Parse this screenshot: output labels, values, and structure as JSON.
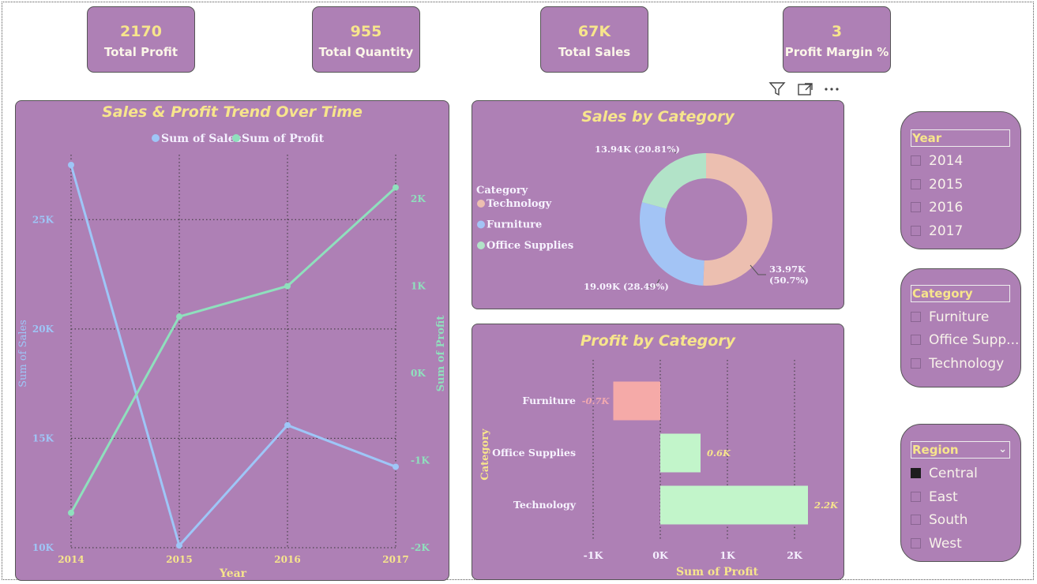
{
  "kpis": [
    {
      "value": "2170",
      "label": "Total Profit"
    },
    {
      "value": "955",
      "label": "Total Quantity"
    },
    {
      "value": "67K",
      "label": "Total Sales"
    },
    {
      "value": "3",
      "label": "Profit Margin %"
    }
  ],
  "colors": {
    "panel": "#ae80b5",
    "sales": "#9ec6f7",
    "profit": "#8fe0bd",
    "title": "#f7e58c",
    "technology": "#ecbfb0",
    "furniture": "#a3c4f5",
    "office": "#b2e3c8",
    "negative_bar": "#f5aaa8",
    "positive_bar": "#c2f5ca"
  },
  "icons": [
    "filter-icon",
    "focus-mode-icon",
    "more-options-icon"
  ],
  "slicers": {
    "year": {
      "header": "Year",
      "items": [
        "2014",
        "2015",
        "2016",
        "2017"
      ]
    },
    "category": {
      "header": "Category",
      "items": [
        "Furniture",
        "Office Supp...",
        "Technology"
      ]
    },
    "region": {
      "header": "Region",
      "items": [
        "Central",
        "East",
        "South",
        "West"
      ],
      "checked": [
        "Central"
      ]
    }
  },
  "chart_data": [
    {
      "type": "line",
      "title": "Sales & Profit Trend Over Time",
      "x": [
        "2014",
        "2015",
        "2016",
        "2017"
      ],
      "xlabel": "Year",
      "series": [
        {
          "name": "Sum of Sales",
          "axis": "left",
          "values": [
            27500,
            10100,
            15600,
            13700
          ]
        },
        {
          "name": "Sum of Profit",
          "axis": "right",
          "values": [
            -1600,
            650,
            1000,
            2130
          ]
        }
      ],
      "ylabel": "Sum of Sales",
      "ylim": [
        10000,
        27500
      ],
      "yticks": [
        10000,
        15000,
        20000,
        25000
      ],
      "ytick_labels": [
        "10K",
        "15K",
        "20K",
        "25K"
      ],
      "y2label": "Sum of Profit",
      "y2lim": [
        -2000,
        2000
      ],
      "y2ticks": [
        -2000,
        -1000,
        0,
        1000,
        2000
      ],
      "y2tick_labels": [
        "-2K",
        "-1K",
        "0K",
        "1K",
        "2K"
      ],
      "legend": "top",
      "grid": true
    },
    {
      "type": "pie",
      "title": "Sales by Category",
      "legend_title": "Category",
      "categories": [
        "Technology",
        "Furniture",
        "Office Supplies"
      ],
      "values": [
        33970,
        19090,
        13940
      ],
      "labels": [
        "33.97K",
        "(50.7%)",
        "19.09K (28.49%)",
        "13.94K (20.81%)"
      ],
      "legend": "left"
    },
    {
      "type": "bar",
      "orientation": "horizontal",
      "title": "Profit by Category",
      "categories": [
        "Furniture",
        "Office Supplies",
        "Technology"
      ],
      "values": [
        -0.7,
        0.6,
        2.2
      ],
      "value_labels": [
        "-0.7K",
        "0.6K",
        "2.2K"
      ],
      "xlabel": "Sum of Profit",
      "ylabel": "Category",
      "xlim": [
        -1,
        2
      ],
      "xticks": [
        -1,
        0,
        1,
        2
      ],
      "xtick_labels": [
        "-1K",
        "0K",
        "1K",
        "2K"
      ],
      "grid": true
    }
  ]
}
